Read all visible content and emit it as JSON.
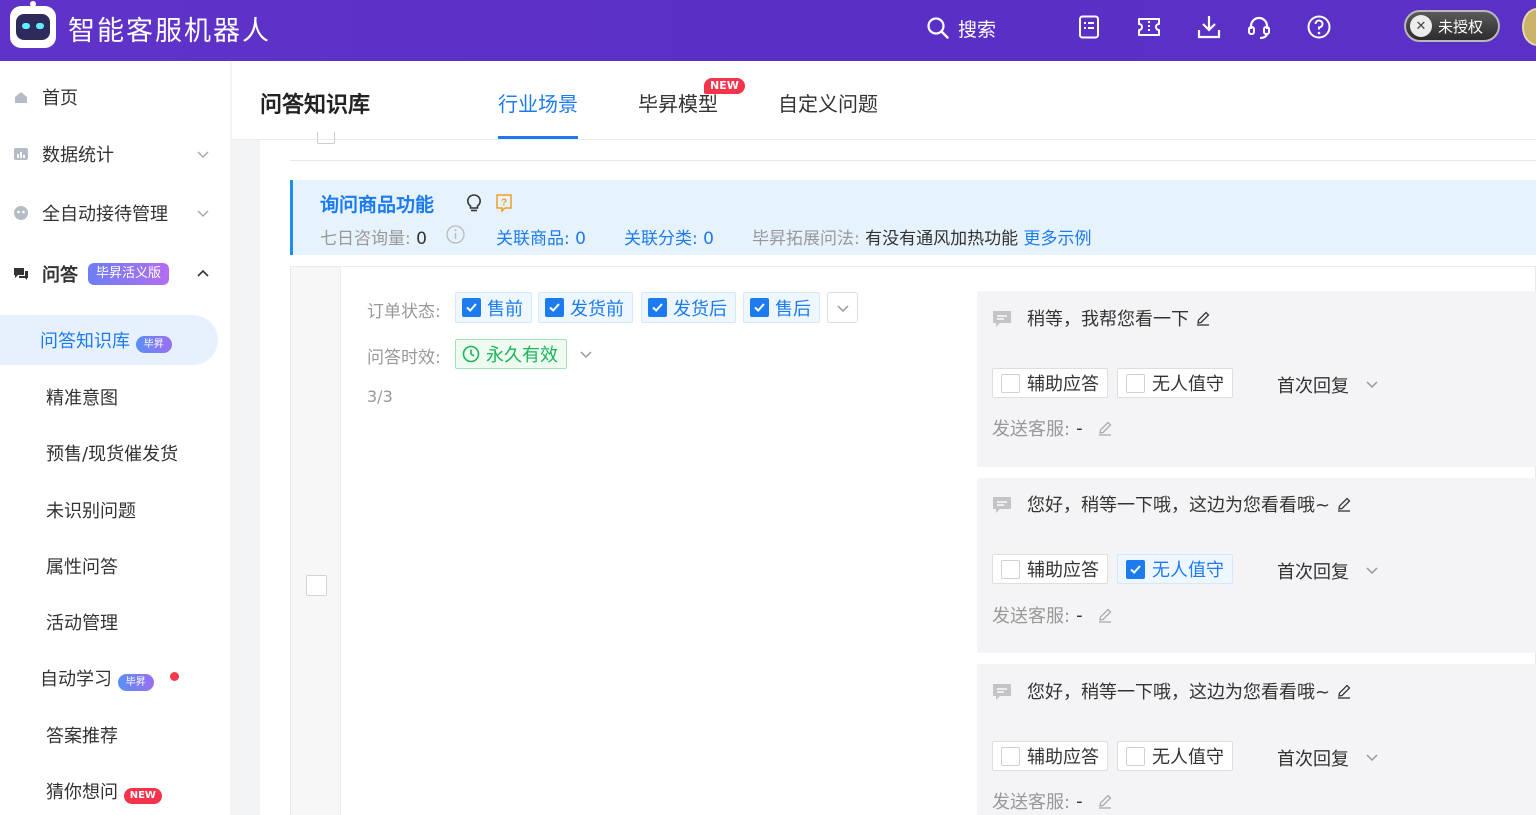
{
  "app": {
    "title": "智能客服机器人",
    "search_label": "搜索",
    "auth_label": "未授权",
    "accent": "#1d7bf0",
    "topbar_color": "#5a2fc6"
  },
  "sidebar": {
    "home": "首页",
    "stats": "数据统计",
    "auto": "全自动接待管理",
    "qa": "问答",
    "qa_badge": "毕昇活义版",
    "items": [
      {
        "label": "问答知识库",
        "badge": "毕昇"
      },
      {
        "label": "精准意图"
      },
      {
        "label": "预售/现货催发货"
      },
      {
        "label": "未识别问题"
      },
      {
        "label": "属性问答"
      },
      {
        "label": "活动管理"
      },
      {
        "label": "自动学习",
        "badge": "毕昇"
      },
      {
        "label": "答案推荐"
      },
      {
        "label": "猜你想问",
        "badge": "NEW"
      }
    ]
  },
  "header": {
    "page_title": "问答知识库",
    "tabs": [
      {
        "label": "行业场景",
        "active": true
      },
      {
        "label": "毕昇模型",
        "badge": "NEW"
      },
      {
        "label": "自定义问题"
      }
    ]
  },
  "question": {
    "title": "询问商品功能",
    "seven_day_label": "七日咨询量:",
    "seven_day_value": "0",
    "linked_goods_label": "关联商品:",
    "linked_goods_value": "0",
    "linked_cat_label": "关联分类:",
    "linked_cat_value": "0",
    "expand_label": "毕昇拓展问法:",
    "expand_value": "有没有通风加热功能",
    "more_examples": "更多示例"
  },
  "rule": {
    "order_status_label": "订单状态:",
    "order_status": [
      "售前",
      "发货前",
      "发货后",
      "售后"
    ],
    "validity_label": "问答时效:",
    "validity_value": "永久有效",
    "count": "3/3",
    "replies": [
      {
        "text": "稍等，我帮您看一下",
        "assist": "辅助应答",
        "assist_checked": false,
        "unattended": "无人值守",
        "unattended_checked": false,
        "first_reply": "首次回复",
        "send_label": "发送客服:",
        "send_value": "-"
      },
      {
        "text": "您好，稍等一下哦，这边为您看看哦~",
        "assist": "辅助应答",
        "assist_checked": false,
        "unattended": "无人值守",
        "unattended_checked": true,
        "first_reply": "首次回复",
        "send_label": "发送客服:",
        "send_value": "-"
      },
      {
        "text": "您好，稍等一下哦，这边为您看看哦~",
        "assist": "辅助应答",
        "assist_checked": false,
        "unattended": "无人值守",
        "unattended_checked": false,
        "first_reply": "首次回复",
        "send_label": "发送客服:",
        "send_value": "-"
      }
    ]
  }
}
